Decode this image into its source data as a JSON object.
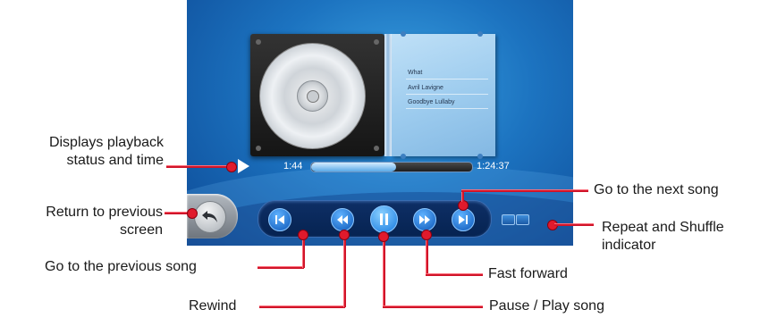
{
  "track": {
    "title": "What",
    "artist": "Avril Lavigne",
    "album": "Goodbye Lullaby"
  },
  "progress": {
    "elapsed": "1:44",
    "total": "1:24:37",
    "fraction": 0.53
  },
  "annotations": {
    "playback_status": [
      "Displays playback",
      "status and time"
    ],
    "return": [
      "Return to previous",
      "screen"
    ],
    "previous_song": "Go to the previous song",
    "rewind": "Rewind",
    "next_song": "Go to the next song",
    "repeat_shuffle": [
      "Repeat and Shuffle",
      "indicator"
    ],
    "fast_forward": "Fast forward",
    "pause_play": "Pause / Play song"
  },
  "colors": {
    "screen_blue": "#1c73c0",
    "accent_red": "#e01a2c",
    "button_blue": "#1679e0"
  },
  "icons": [
    "play-status-icon",
    "back-arrow-icon",
    "skip-previous-icon",
    "rewind-icon",
    "pause-icon",
    "fast-forward-icon",
    "skip-next-icon",
    "repeat-icon",
    "shuffle-icon"
  ]
}
